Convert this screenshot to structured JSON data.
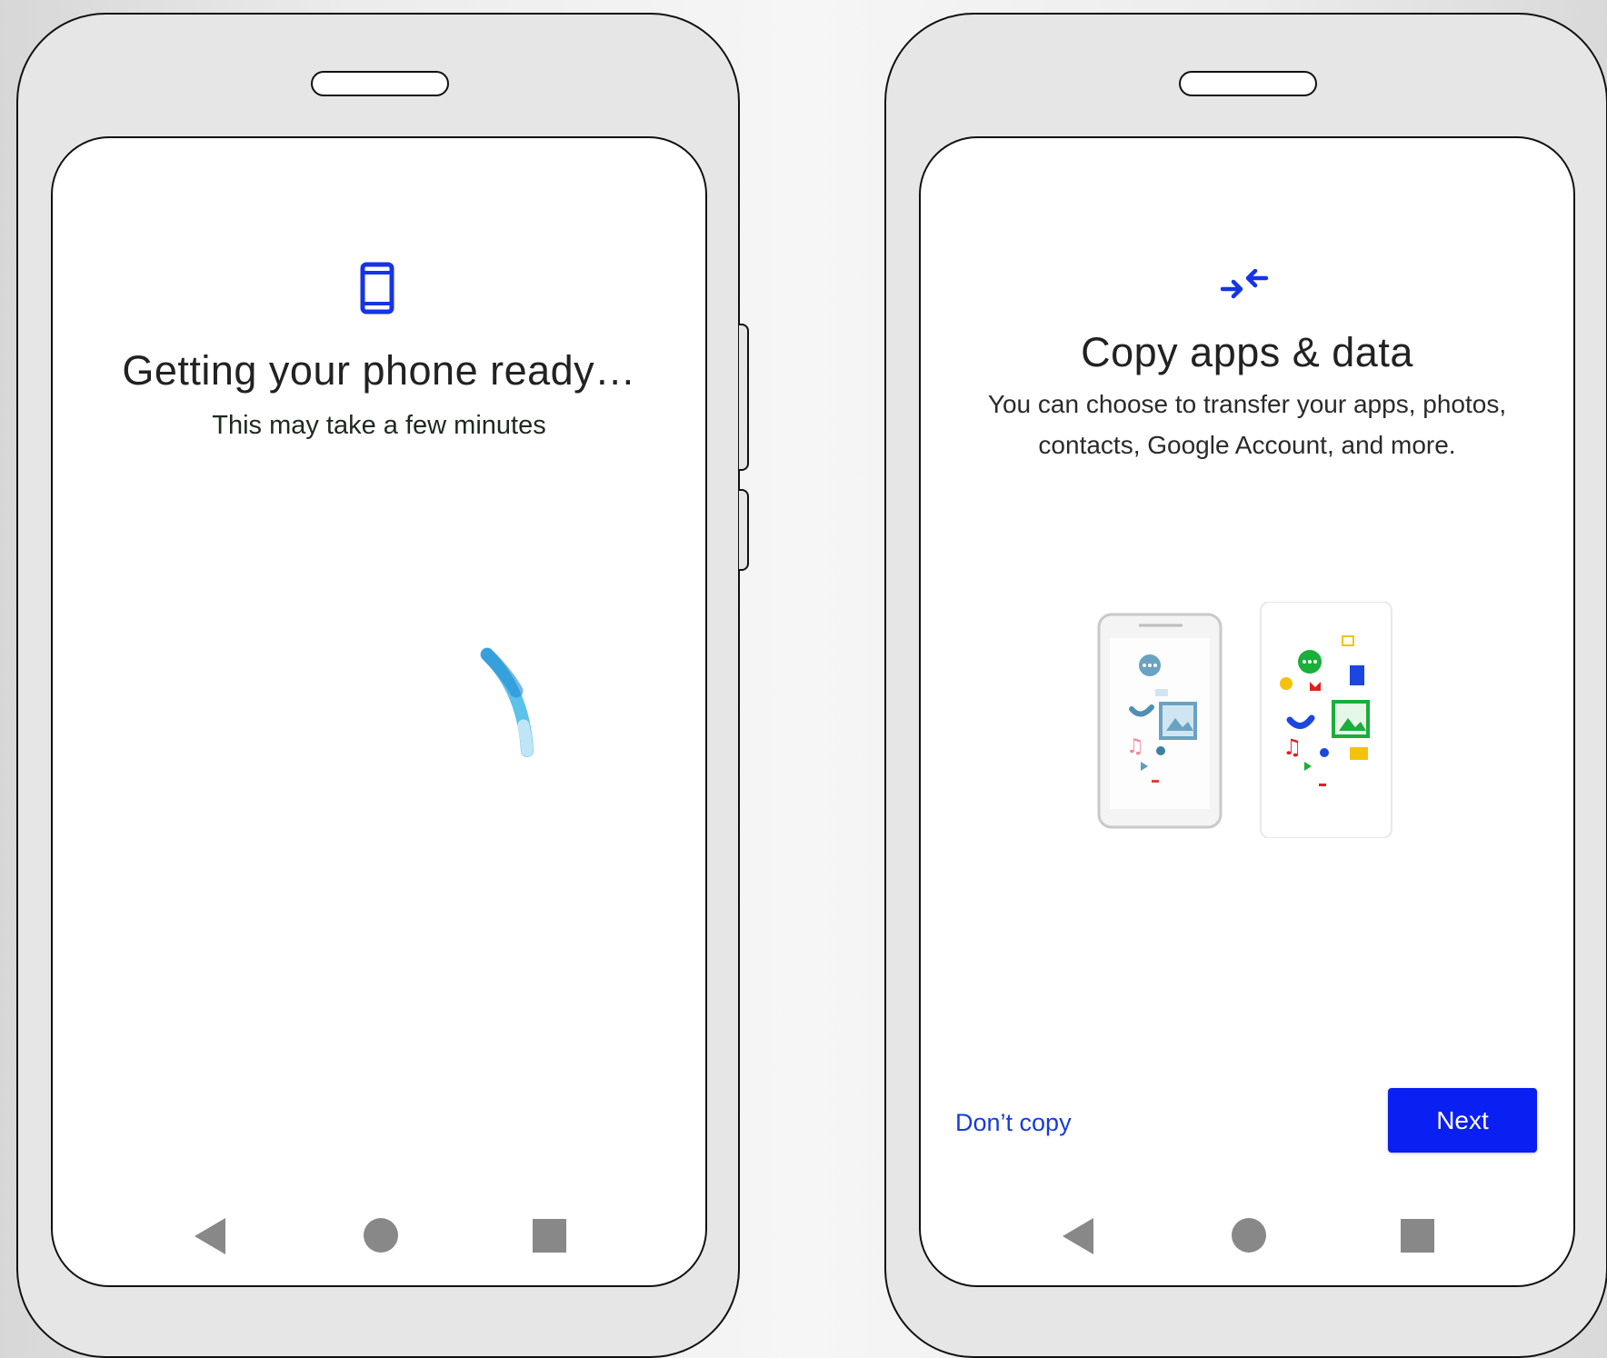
{
  "left_screen": {
    "title": "Getting your phone ready…",
    "subtitle": "This may take a few minutes",
    "icon": "smartphone-icon"
  },
  "right_screen": {
    "title": "Copy apps & data",
    "description": "You can choose to transfer your apps, photos, contacts, Google Account, and more.",
    "icon": "copy-arrows-icon",
    "secondary_button": "Don’t copy",
    "primary_button": "Next"
  },
  "nav_bar": {
    "icons": [
      "back-icon",
      "home-icon",
      "recents-icon"
    ]
  },
  "colors": {
    "accent": "#0a1ff2",
    "link": "#1a3bd6",
    "spinner": "#3fb6e8"
  }
}
